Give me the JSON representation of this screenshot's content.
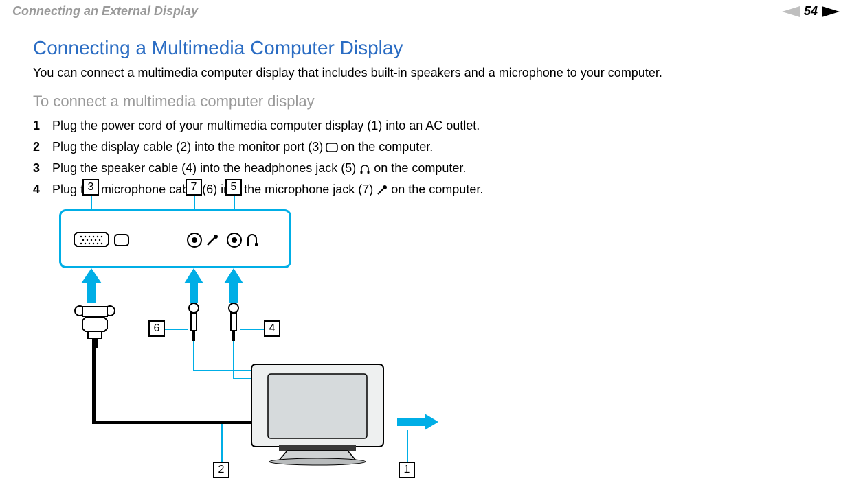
{
  "header": {
    "breadcrumb": "Connecting an External Display",
    "page_number": "54"
  },
  "page": {
    "title": "Connecting a Multimedia Computer Display",
    "intro": "You can connect a multimedia computer display that includes built-in speakers and a microphone to your computer.",
    "subtitle": "To connect a multimedia computer display",
    "steps": [
      {
        "num": "1",
        "pre": "Plug the power cord of your multimedia computer display (1) into an AC outlet.",
        "glyph": "",
        "post": ""
      },
      {
        "num": "2",
        "pre": "Plug the display cable (2) into the monitor port (3) ",
        "glyph": "monitor",
        "post": " on the computer."
      },
      {
        "num": "3",
        "pre": "Plug the speaker cable (4) into the headphones jack (5) ",
        "glyph": "headphones",
        "post": " on the computer."
      },
      {
        "num": "4",
        "pre": "Plug the microphone cable (6) into the microphone jack (7) ",
        "glyph": "microphone",
        "post": " on the computer."
      }
    ]
  },
  "diagram": {
    "callouts": [
      "1",
      "2",
      "3",
      "4",
      "5",
      "6",
      "7"
    ]
  }
}
